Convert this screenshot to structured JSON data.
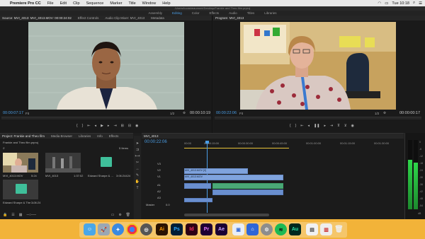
{
  "menubar": {
    "app": "Premiere Pro CC",
    "items": [
      "File",
      "Edit",
      "Clip",
      "Sequence",
      "Marker",
      "Title",
      "Window",
      "Help"
    ],
    "clock": "Tue 10:18"
  },
  "titlebar": "/Users/lucasbeaumont/Desktop/Frankie and Theo film.prproj",
  "workspace_tabs": [
    "Assembly",
    "Editing",
    "Color",
    "Effects",
    "Audio",
    "Titles",
    "Libraries"
  ],
  "workspace_active": "Editing",
  "source": {
    "tabs": [
      "Source: MVI_4013: MVI_4013.MOV: 00:00:24:02",
      "Effect Controls",
      "Audio Clip Mixer: MVI_4013",
      "Metadata"
    ],
    "timecode": "00:00:07:17",
    "fit": "Fit",
    "ratio": "1/2",
    "duration": "00:00:10:19"
  },
  "program": {
    "tabs": [
      "Program: MVI_4013"
    ],
    "timecode": "00:00:22:06",
    "fit": "Fit",
    "ratio": "1/2",
    "duration": "00:00:00:17"
  },
  "project": {
    "tabs": [
      "Project: Frankie and Theo film",
      "Media Browser",
      "Libraries",
      "Info",
      "Effects"
    ],
    "file": "Frankie and Theo film.prproj",
    "count": "5 Items",
    "items": [
      {
        "name": "MVI_4013.MOV",
        "dur": "5:24"
      },
      {
        "name": "MVI_4013",
        "dur": "1:37:02"
      },
      {
        "name": "Edward Sharpe & ...",
        "dur": "3:06:24424"
      },
      {
        "name": "Edward Sharpe & The ...",
        "dur": "3:06:24"
      }
    ]
  },
  "timeline": {
    "tab": "MVI_4013",
    "timecode": "00:00:22:06",
    "ruler": [
      "00:00",
      "00:00:15:00",
      "00:00:30:00",
      "00:00:45:00",
      "00:01:00:00",
      "00:01:15:00",
      "00:01:30:00"
    ],
    "video_tracks": [
      "V3",
      "V2",
      "V1"
    ],
    "audio_tracks": [
      "A1",
      "A2",
      "A3"
    ],
    "master": "Master",
    "master_val": "0.0",
    "clips": [
      "MVI_4013.MOV [V]",
      "MVI_4013.MOV",
      "MVI_4013.MOV"
    ]
  },
  "meter": {
    "scale": [
      "0",
      "-6",
      "-12",
      "-18",
      "-24",
      "-30",
      "-36",
      "-42",
      "-48",
      "-54"
    ],
    "unit": "dB"
  },
  "dock_apps": [
    "Finder",
    "Launchpad",
    "Safari",
    "Chrome",
    "Photos",
    "Illustrator",
    "Photoshop",
    "InDesign",
    "Premiere Pro",
    "After Effects",
    "Preview",
    "Keynote",
    "System Preferences",
    "Spotify",
    "Audition",
    "Screenshots",
    "Media",
    "Trash"
  ]
}
